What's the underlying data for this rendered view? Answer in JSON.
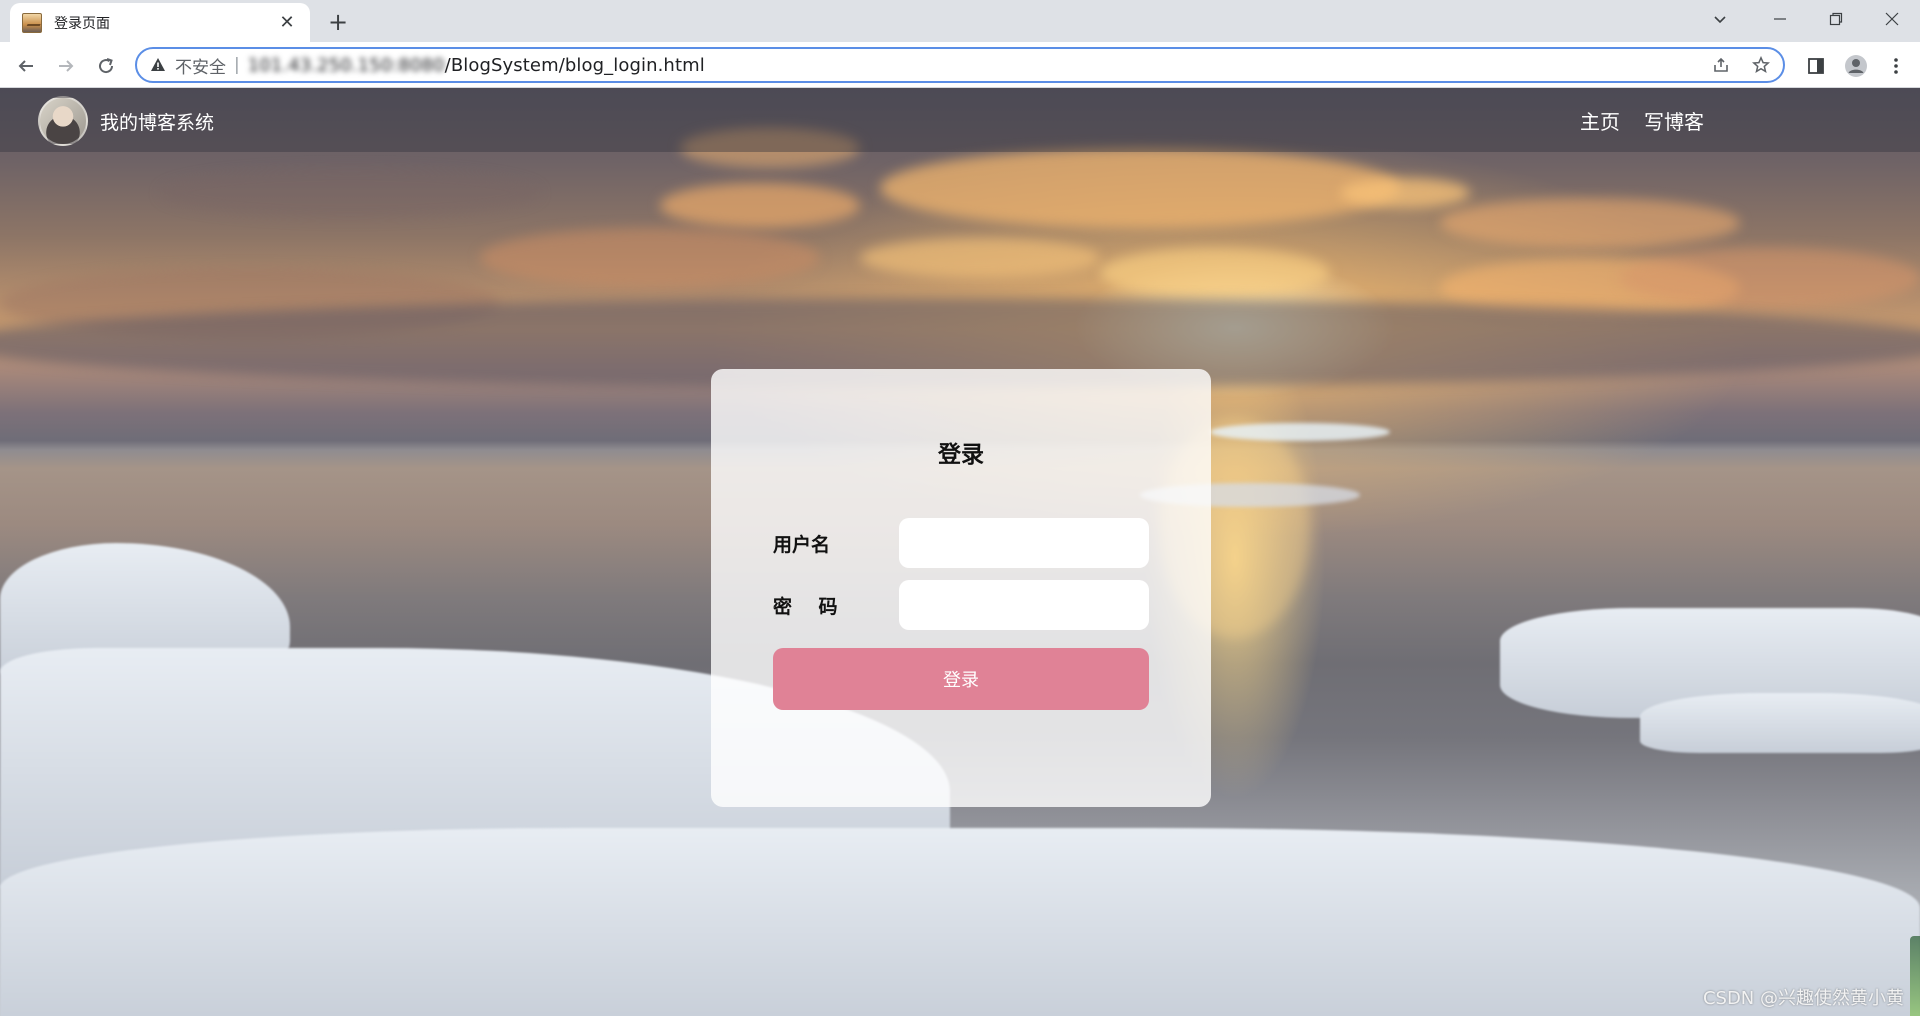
{
  "browser": {
    "tab_title": "登录页面",
    "tab_close_icon": "close-icon",
    "new_tab_icon": "plus-icon",
    "security_label": "不安全",
    "url_host": "101.43.250.150:8080",
    "url_path": "/BlogSystem/blog_login.html",
    "window_controls": [
      "tab-search-icon",
      "minimize-icon",
      "restore-icon",
      "close-icon"
    ],
    "accent_color": "#5b8ee6"
  },
  "navbar": {
    "site_title": "我的博客系统",
    "links": [
      {
        "label": "主页"
      },
      {
        "label": "写博客"
      }
    ]
  },
  "login": {
    "title": "登录",
    "username_label": "用户名",
    "password_label": "密    码",
    "username_value": "",
    "password_value": "",
    "submit_label": "登录",
    "button_color": "#e08296"
  },
  "watermark": "CSDN @兴趣使然黄小黄"
}
